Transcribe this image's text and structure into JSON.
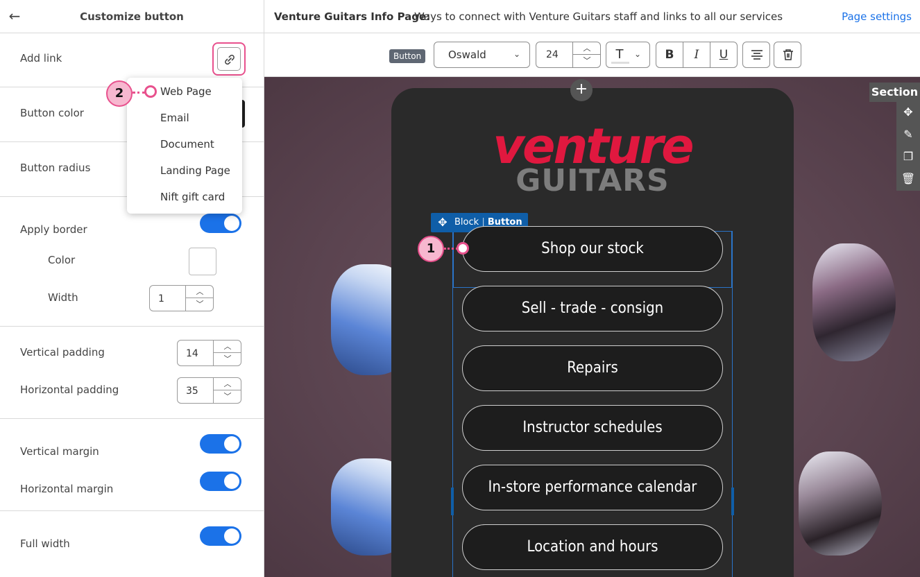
{
  "panel": {
    "title": "Customize button",
    "add_link": "Add link",
    "button_color": "Button color",
    "button_radius": "Button radius",
    "apply_border": "Apply border",
    "color": "Color",
    "width": "Width",
    "width_value": "1",
    "vertical_padding": "Vertical padding",
    "vertical_padding_value": "14",
    "horizontal_padding": "Horizontal padding",
    "horizontal_padding_value": "35",
    "vertical_margin": "Vertical margin",
    "horizontal_margin": "Horizontal margin",
    "full_width": "Full width"
  },
  "link_menu": {
    "items": [
      "Web Page",
      "Email",
      "Document",
      "Landing Page",
      "Nift gift card"
    ]
  },
  "callouts": [
    "1",
    "2"
  ],
  "header": {
    "page_name": "Venture Guitars Info Page:",
    "page_description": "Ways to connect with Venture Guitars staff and links to all our services",
    "page_settings": "Page settings"
  },
  "toolbar": {
    "tag": "Button",
    "font": "Oswald",
    "size": "24"
  },
  "canvas": {
    "logo_top": "venture",
    "logo_bottom": "GUITARS",
    "block_label": "Block",
    "block_type": "Button",
    "buttons": [
      "Shop our stock",
      "Sell - trade - consign",
      "Repairs",
      "Instructor schedules",
      "In-store performance calendar",
      "Location and hours"
    ],
    "section_label": "Section"
  },
  "colors": {
    "accent": "#1b72e8",
    "callout": "#e8518d",
    "logo_red": "#e0183f",
    "selection": "#0f5ea8"
  }
}
